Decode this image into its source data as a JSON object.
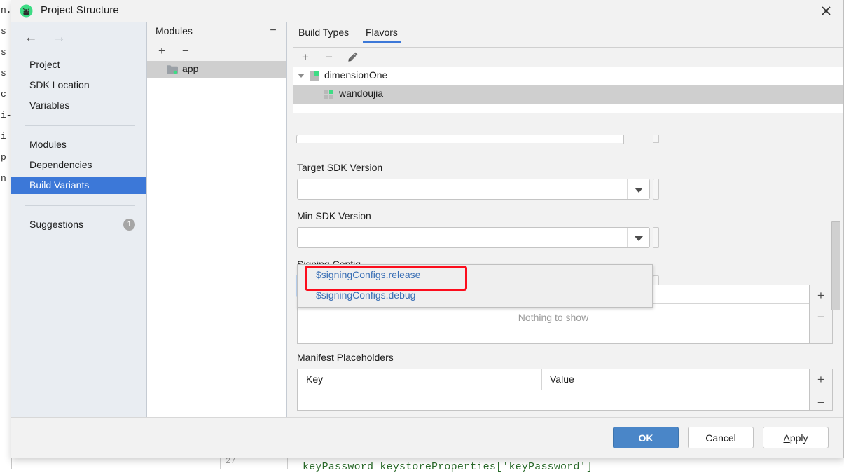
{
  "ide": {
    "left_fragments": [
      "n.",
      "s",
      "s",
      "s",
      "c",
      "i-",
      "",
      "",
      "i",
      "p",
      "",
      "n"
    ],
    "code_line": "keyPassword keystoreProperties['keyPassword']",
    "gutter_line_number": "27"
  },
  "dialog": {
    "title": "Project Structure",
    "title_icon": "android-studio-icon",
    "close_icon": "close-icon"
  },
  "sidebar": {
    "back_icon": "arrow-left-icon",
    "forward_icon": "arrow-right-icon",
    "items": [
      {
        "label": "Project",
        "selected": false
      },
      {
        "label": "SDK Location",
        "selected": false
      },
      {
        "label": "Variables",
        "selected": false
      },
      {
        "label": "Modules",
        "selected": false
      },
      {
        "label": "Dependencies",
        "selected": false
      },
      {
        "label": "Build Variants",
        "selected": true
      },
      {
        "label": "Suggestions",
        "selected": false,
        "badge": "1"
      }
    ]
  },
  "modules": {
    "title": "Modules",
    "collapse_icon": "minus-icon",
    "add_icon": "plus-icon",
    "remove_icon": "minus-icon",
    "rows": [
      {
        "label": "app",
        "icon": "module-folder-icon",
        "selected": true
      }
    ]
  },
  "content": {
    "tabs": [
      {
        "label": "Build Types",
        "active": false
      },
      {
        "label": "Flavors",
        "active": true
      }
    ],
    "flavor_toolbar": {
      "add_icon": "plus-icon",
      "remove_icon": "minus-icon",
      "edit_icon": "pencil-icon"
    },
    "flavor_tree": [
      {
        "label": "dimensionOne",
        "icon": "flavor-dimension-icon",
        "level": 0,
        "expanded": true,
        "selected": false
      },
      {
        "label": "wandoujia",
        "icon": "flavor-icon",
        "level": 1,
        "selected": true,
        "highlighted": true
      }
    ],
    "fields": [
      {
        "label": "Target SDK Version",
        "value": "",
        "focused": false
      },
      {
        "label": "Min SDK Version",
        "value": "",
        "focused": false
      },
      {
        "label": "Signing Config",
        "value": "",
        "focused": true
      }
    ],
    "dropdown": {
      "open": true,
      "options": [
        {
          "label": "$signingConfigs.release",
          "highlighted": true
        },
        {
          "label": "$signingConfigs.debug",
          "highlighted": false
        }
      ]
    },
    "proguard_list": {
      "empty_text": "Nothing to show",
      "add_icon": "plus-icon",
      "remove_icon": "minus-icon"
    },
    "manifest_placeholders": {
      "label": "Manifest Placeholders",
      "columns": [
        "Key",
        "Value"
      ],
      "rows": [],
      "add_icon": "plus-icon"
    }
  },
  "footer": {
    "buttons": [
      {
        "label": "OK",
        "primary": true
      },
      {
        "label": "Cancel",
        "primary": false
      },
      {
        "label": "Apply",
        "primary": false,
        "mnemonic": "A"
      }
    ]
  },
  "colors": {
    "accent_blue": "#3c78d8",
    "primary_button": "#4a86c8",
    "highlight_red": "#fc0d1c",
    "link_blue": "#3a6fb5",
    "selection_gray": "#cfcfcf",
    "sidebar_bg": "#e9edf2"
  }
}
